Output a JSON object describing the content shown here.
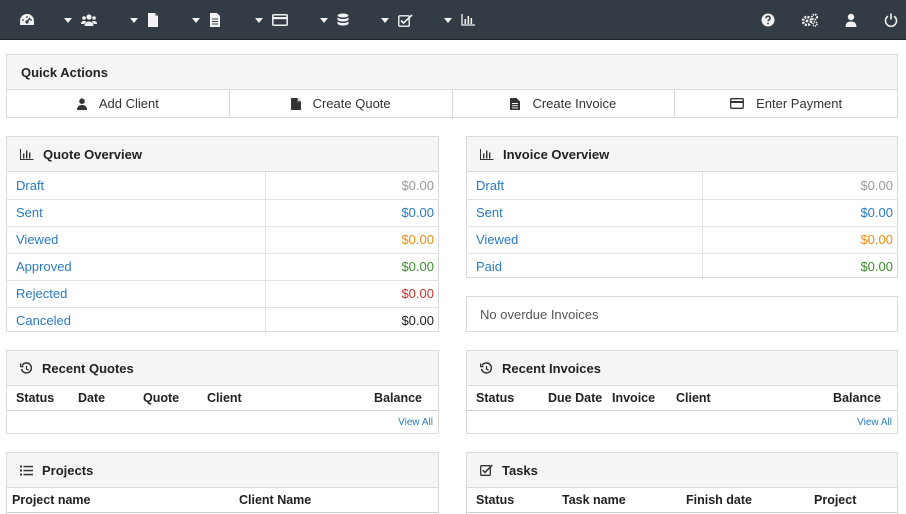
{
  "navbar": {
    "left_icons": [
      "dashboard-icon",
      "clients-icon",
      "quotes-icon",
      "invoices-icon",
      "payments-icon",
      "products-icon",
      "tasks-icon",
      "reports-icon"
    ],
    "right_icons": [
      "help-icon",
      "settings-icon",
      "user-icon",
      "logout-icon"
    ],
    "color": "#333c45"
  },
  "quick_actions": {
    "title": "Quick Actions",
    "buttons": [
      {
        "label": "Add Client",
        "icon": "user-icon"
      },
      {
        "label": "Create Quote",
        "icon": "file-icon"
      },
      {
        "label": "Create Invoice",
        "icon": "file-text-icon"
      },
      {
        "label": "Enter Payment",
        "icon": "credit-card-icon"
      }
    ]
  },
  "quote_overview": {
    "title": "Quote Overview",
    "rows": [
      {
        "label": "Draft",
        "amount": "$0.00",
        "color": "#999999"
      },
      {
        "label": "Sent",
        "amount": "$0.00",
        "color": "#2a7ac0"
      },
      {
        "label": "Viewed",
        "amount": "$0.00",
        "color": "#ef8c0e"
      },
      {
        "label": "Approved",
        "amount": "$0.00",
        "color": "#3c8c2f"
      },
      {
        "label": "Rejected",
        "amount": "$0.00",
        "color": "#c9302c"
      },
      {
        "label": "Canceled",
        "amount": "$0.00",
        "color": "#222222"
      }
    ]
  },
  "invoice_overview": {
    "title": "Invoice Overview",
    "rows": [
      {
        "label": "Draft",
        "amount": "$0.00",
        "color": "#999999"
      },
      {
        "label": "Sent",
        "amount": "$0.00",
        "color": "#2a7ac0"
      },
      {
        "label": "Viewed",
        "amount": "$0.00",
        "color": "#ef8c0e"
      },
      {
        "label": "Paid",
        "amount": "$0.00",
        "color": "#3c8c2f"
      }
    ]
  },
  "overdue": {
    "text": "No overdue Invoices"
  },
  "recent_quotes": {
    "title": "Recent Quotes",
    "columns": [
      "Status",
      "Date",
      "Quote",
      "Client",
      "Balance"
    ],
    "view_all": "View All"
  },
  "recent_invoices": {
    "title": "Recent Invoices",
    "columns": [
      "Status",
      "Due Date",
      "Invoice",
      "Client",
      "Balance"
    ],
    "view_all": "View All"
  },
  "projects": {
    "title": "Projects",
    "columns": [
      "Project name",
      "Client Name"
    ]
  },
  "tasks": {
    "title": "Tasks",
    "columns": [
      "Status",
      "Task name",
      "Finish date",
      "Project"
    ]
  }
}
